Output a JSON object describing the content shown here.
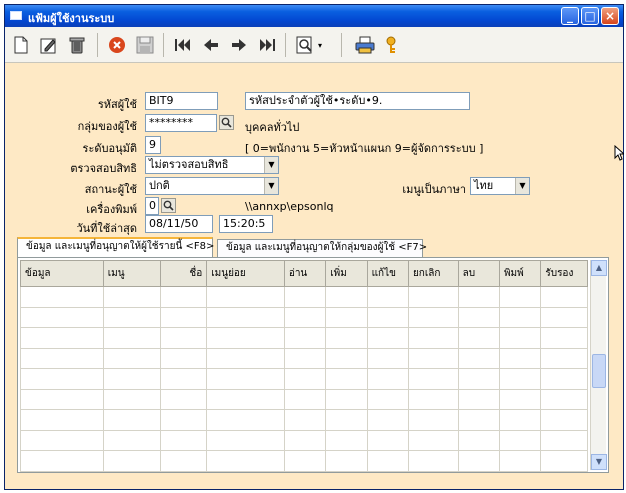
{
  "window": {
    "title": "แฟ้มผู้ใช้งานระบบ"
  },
  "toolbar": {
    "icons": [
      "new-icon",
      "edit-icon",
      "delete-icon",
      "cancel-icon",
      "save-icon",
      "first-icon",
      "previous-icon",
      "next-icon",
      "last-icon",
      "search-icon",
      "dropdown-icon",
      "print-icon",
      "key-icon"
    ]
  },
  "form": {
    "user_code_label": "รหัสผู้ใช้",
    "user_code_value": "BIT9",
    "user_desc_value": "รหัสประจำตัวผู้ใช้•ระดับ•9.",
    "group_label": "กลุ่มของผู้ใช้",
    "group_value": "********",
    "group_desc": "บุคคลทั่วไป",
    "level_label": "ระดับอนุมัติ",
    "level_value": "9",
    "level_hint": "[ 0=พนักงาน  5=หัวหน้าแผนก  9=ผู้จัดการระบบ ]",
    "check_rights_label": "ตรวจสอบสิทธิ",
    "check_rights_value": "ไม่ตรวจสอบสิทธิ",
    "status_label": "สถานะผู้ใช้",
    "status_value": "ปกติ",
    "menu_lang_label": "เมนูเป็นภาษา",
    "menu_lang_value": "ไทย",
    "printer_label": "เครื่องพิมพ์",
    "printer_value": "0",
    "printer_path": "\\\\annxp\\epsonlq",
    "last_used_label": "วันที่ใช้ล่าสุด",
    "last_used_date": "08/11/50",
    "last_used_time": "15:20:5"
  },
  "tabs": [
    {
      "label": "ข้อมูล และเมนูที่อนุญาตให้ผู้ใช้รายนี้ <F8>"
    },
    {
      "label": "ข้อมูล และเมนูที่อนุญาตให้กลุ่มของผู้ใช้ <F7>"
    }
  ],
  "table": {
    "columns": [
      "ข้อมูล",
      "เมนู",
      "ชื่อ",
      "เมนูย่อย",
      "อ่าน",
      "เพิ่ม",
      "แก้ไข",
      "ยกเลิก",
      "ลบ",
      "พิมพ์",
      "รับรอง"
    ]
  }
}
